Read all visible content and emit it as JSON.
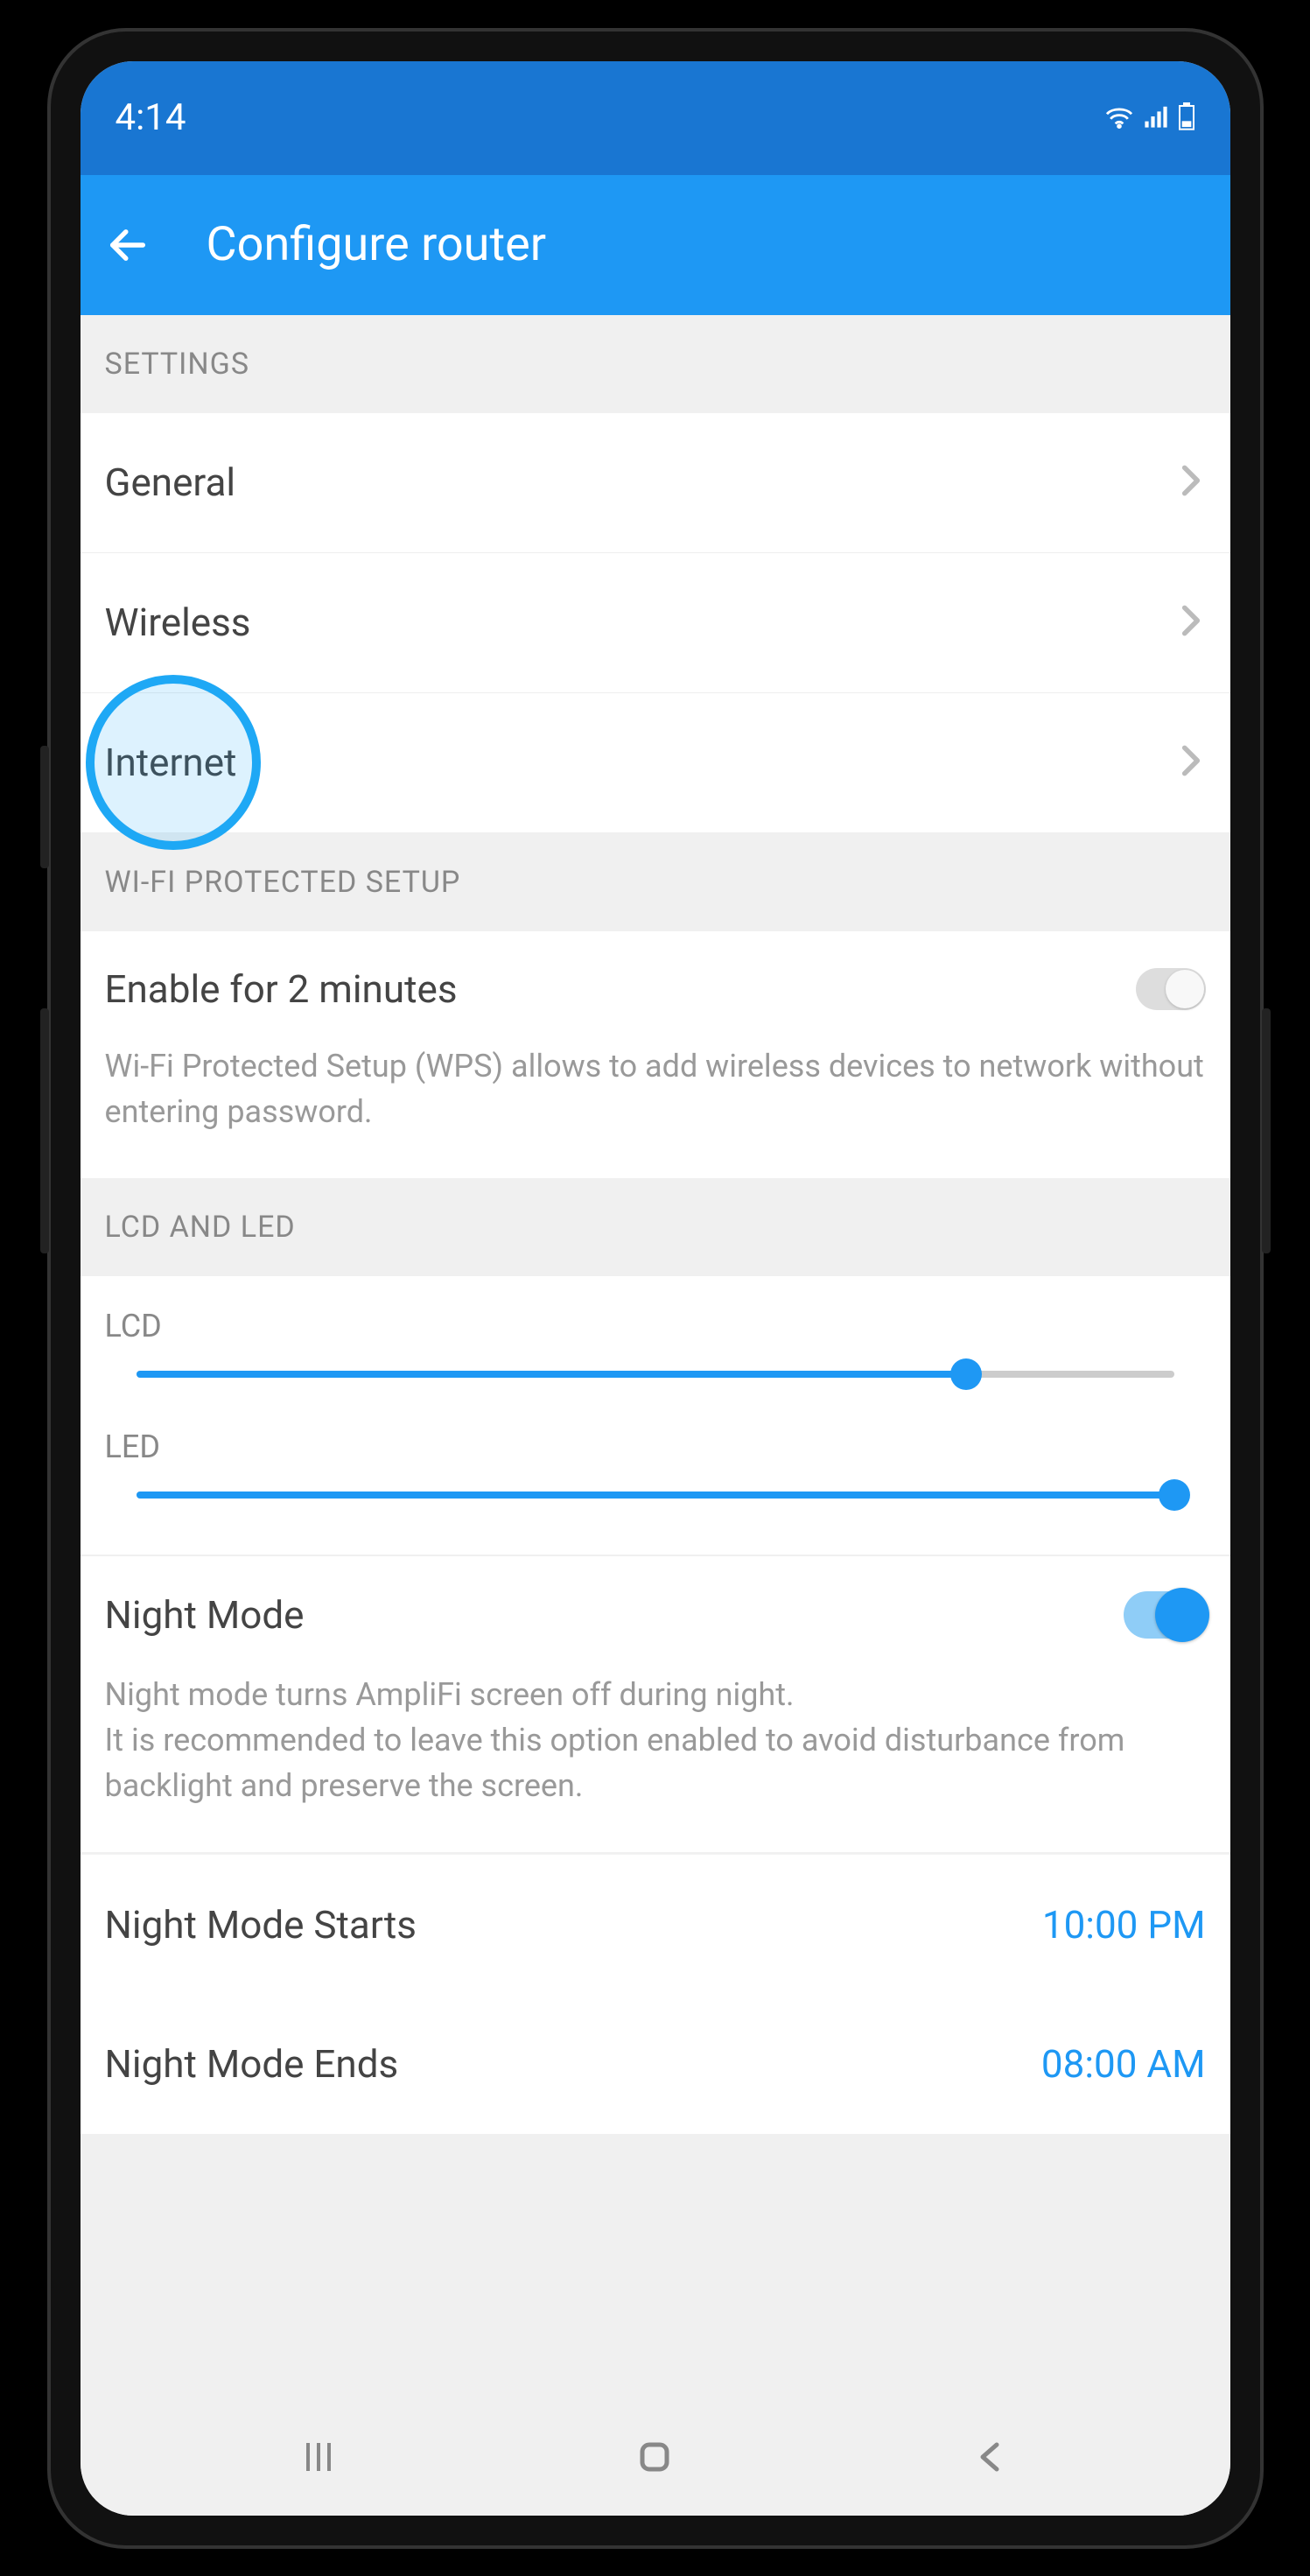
{
  "status": {
    "time": "4:14"
  },
  "header": {
    "title": "Configure router"
  },
  "sections": {
    "settings": {
      "header": "SETTINGS",
      "items": [
        "General",
        "Wireless",
        "Internet"
      ]
    },
    "wps": {
      "header": "WI-FI PROTECTED SETUP",
      "label": "Enable for 2 minutes",
      "enabled": false,
      "desc": "Wi-Fi Protected Setup (WPS) allows to add wireless devices to network without entering password."
    },
    "lcd_led": {
      "header": "LCD AND LED",
      "lcd": {
        "label": "LCD",
        "value": 80
      },
      "led": {
        "label": "LED",
        "value": 100
      }
    },
    "night": {
      "label": "Night Mode",
      "enabled": true,
      "desc": "Night mode turns AmpliFi screen off during night.\nIt is recommended to leave this option enabled to avoid disturbance from backlight and preserve the screen.",
      "starts": {
        "label": "Night Mode Starts",
        "value": "10:00 PM"
      },
      "ends": {
        "label": "Night Mode Ends",
        "value": "08:00 AM"
      }
    }
  }
}
